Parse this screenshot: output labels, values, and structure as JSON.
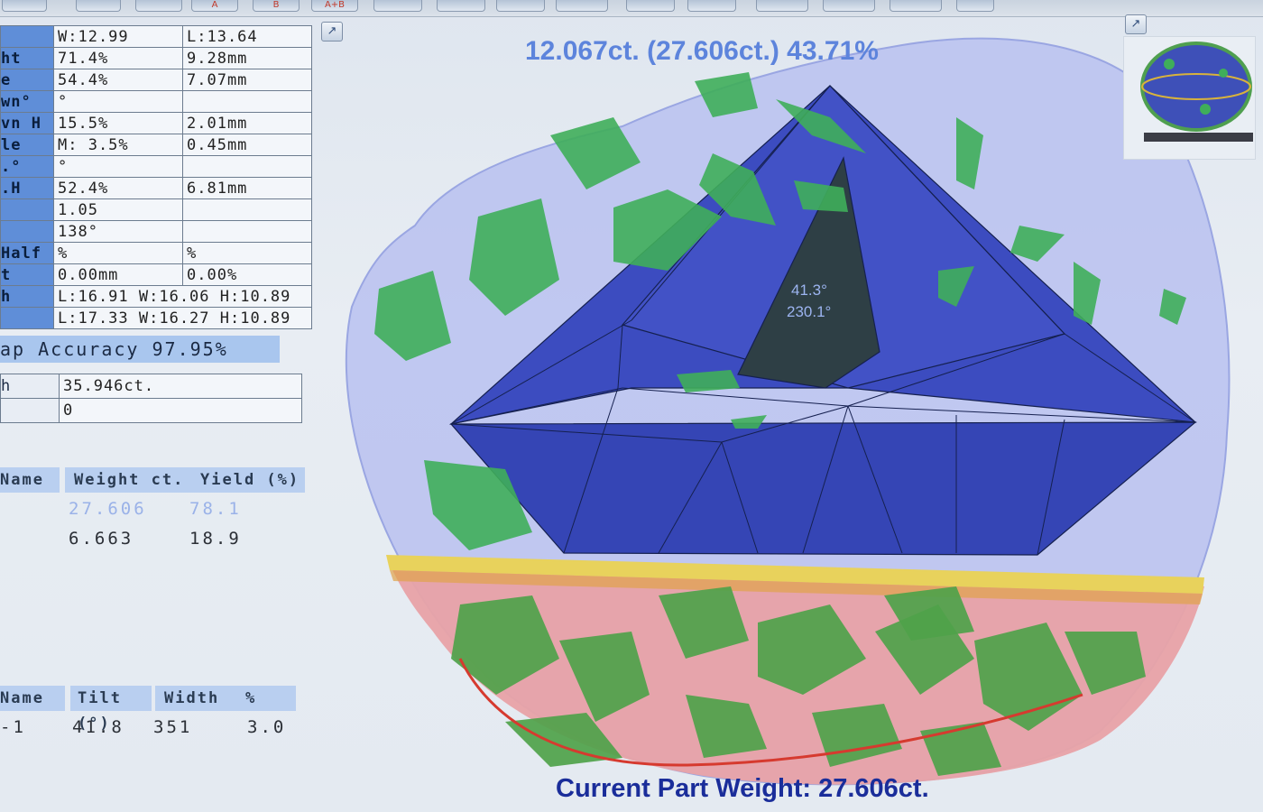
{
  "toolbar": {
    "buttons": [
      "",
      "",
      "A",
      "B",
      "A+B",
      "",
      "",
      "",
      "",
      "",
      "",
      "",
      "",
      ""
    ]
  },
  "params": {
    "rows": [
      {
        "label": "",
        "v1": "W:12.99",
        "v2": "L:13.64"
      },
      {
        "label": "ht",
        "v1": "71.4%",
        "v2": "9.28mm"
      },
      {
        "label": "e",
        "v1": "54.4%",
        "v2": "7.07mm"
      },
      {
        "label": "wn°",
        "v1": "°",
        "v2": ""
      },
      {
        "label": "vn H",
        "v1": "15.5%",
        "v2": "2.01mm"
      },
      {
        "label": "le",
        "v1": "M: 3.5%",
        "v2": "0.45mm"
      },
      {
        "label": ".°",
        "v1": "°",
        "v2": ""
      },
      {
        "label": ".H",
        "v1": "52.4%",
        "v2": "6.81mm"
      },
      {
        "label": "",
        "v1": "1.05",
        "v2": ""
      },
      {
        "label": "",
        "v1": "138°",
        "v2": ""
      },
      {
        "label": "Half",
        "v1": "%",
        "v2": "%"
      },
      {
        "label": "t",
        "v1": "0.00mm",
        "v2": "0.00%"
      },
      {
        "label": "h",
        "v1": "L:16.91 W:16.06 H:10.89",
        "v2": null
      },
      {
        "label": "",
        "v1": "L:17.33 W:16.27 H:10.89",
        "v2": null
      }
    ],
    "accuracy_label": "ap Accuracy  97.95%"
  },
  "weights": {
    "rows": [
      {
        "label": "h",
        "value": "35.946ct."
      },
      {
        "label": "",
        "value": "0"
      }
    ]
  },
  "parts_table": {
    "headers": [
      "Name",
      "Weight ct.",
      "Yield (%)"
    ],
    "rows": [
      {
        "name": "",
        "weight": "27.606",
        "yield": "78.1",
        "selected": true
      },
      {
        "name": "",
        "weight": "6.663",
        "yield": "18.9",
        "selected": false
      }
    ]
  },
  "planes_table": {
    "headers": [
      "Name",
      "Tilt (°)",
      "Width",
      "%"
    ],
    "rows": [
      {
        "name": "-1",
        "tilt": "41.8",
        "width": "351",
        "pct": "3.0"
      }
    ]
  },
  "viewer": {
    "top_title": "12.067ct. (27.606ct.) 43.71%",
    "angle_line1": "41.3°",
    "angle_line2": "230.1°",
    "bottom_title": "Current Part Weight: 27.606ct.",
    "expand_icon": "↗"
  },
  "colors": {
    "rough_stone": "#b7c0ef",
    "polished_part": "#3e4fb8",
    "inclusions": "#3fae5a",
    "lower_part": "#e7a0a4",
    "cut_plane": "#e5c85a"
  }
}
